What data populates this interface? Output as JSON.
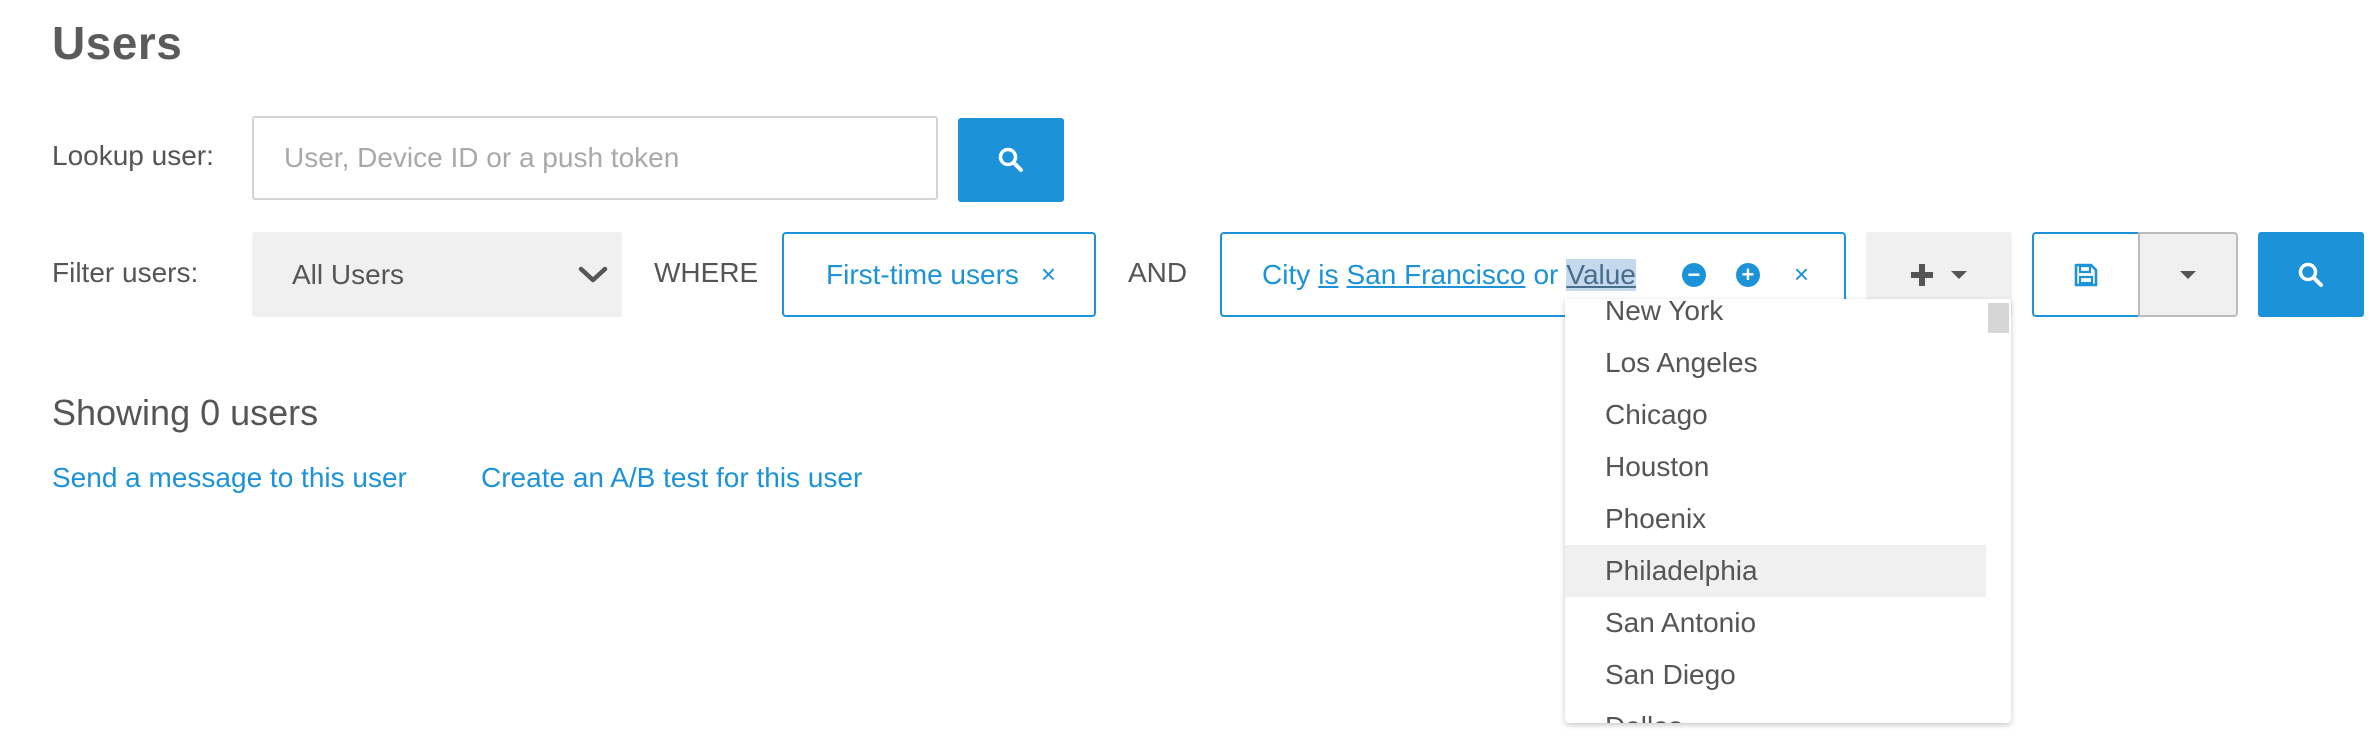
{
  "page": {
    "title": "Users"
  },
  "lookup": {
    "label": "Lookup user:",
    "placeholder": "User, Device ID or a push token"
  },
  "filter": {
    "label": "Filter users:",
    "segment": "All Users",
    "where": "WHERE",
    "and": "AND",
    "chip1": {
      "text": "First-time users",
      "remove": "×"
    },
    "chip2": {
      "field": "City",
      "op": "is",
      "value": "San Francisco",
      "or": "or",
      "placeholder_value": "Value",
      "remove": "×"
    }
  },
  "icons": {
    "search": "search-icon",
    "save": "floppy-disk-icon",
    "add": "plus-icon",
    "caret": "caret-down-icon",
    "minus": "minus-circle-icon",
    "plus_circle": "plus-circle-icon"
  },
  "results": {
    "summary": "Showing 0 users",
    "links": [
      "Send a message to this user",
      "Create an A/B test for this user"
    ]
  },
  "city_dropdown": {
    "options": [
      "New York",
      "Los Angeles",
      "Chicago",
      "Houston",
      "Phoenix",
      "Philadelphia",
      "San Antonio",
      "San Diego",
      "Dallas"
    ],
    "highlighted": "Philadelphia"
  },
  "colors": {
    "accent": "#1c93d8",
    "text": "#555555",
    "muted": "#a9a9a9",
    "surface": "#f0f0f0"
  }
}
